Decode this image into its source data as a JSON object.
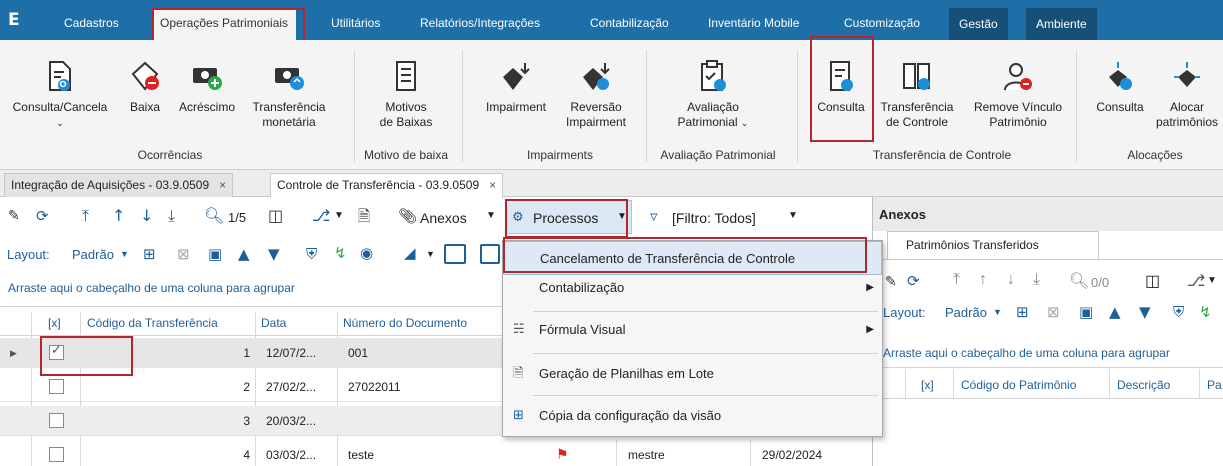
{
  "menubar": {
    "logo": "E",
    "tabs": [
      "Cadastros",
      "Operações Patrimoniais",
      "Utilitários",
      "Relatórios/Integrações",
      "Contabilização",
      "Inventário Mobile",
      "Customização",
      "Gestão",
      "Ambiente"
    ]
  },
  "ribbon": {
    "items": {
      "consulta_cancela": "Consulta/Cancela",
      "baixa": "Baixa",
      "acrescimo": "Acréscimo",
      "transf_monetaria_1": "Transferência",
      "transf_monetaria_2": "monetária",
      "motivos_1": "Motivos",
      "motivos_2": "de Baixas",
      "impairment": "Impairment",
      "reversao_1": "Reversão",
      "reversao_2": "Impairment",
      "avaliacao_1": "Avaliação",
      "avaliacao_2": "Patrimonial",
      "consulta": "Consulta",
      "transf_controle_1": "Transferência",
      "transf_controle_2": "de Controle",
      "remove_vinculo_1": "Remove Vínculo",
      "remove_vinculo_2": "Patrimônio",
      "alocacoes_consulta": "Consulta",
      "alocar_1": "Alocar",
      "alocar_2": "patrimônios"
    },
    "groups": {
      "ocorrencias": "Ocorrências",
      "motivo_baixa": "Motivo de baixa",
      "impairments": "Impairments",
      "avaliacao": "Avaliação Patrimonial",
      "transf_controle": "Transferência de Controle",
      "alocacoes": "Alocações"
    }
  },
  "doctabs": [
    {
      "label": "Integração de Aquisições - 03.9.0509"
    },
    {
      "label": "Controle de Transferência - 03.9.0509"
    }
  ],
  "toolbar": {
    "page": "1/5",
    "anexos": "Anexos",
    "processos": "Processos",
    "filtro": "[Filtro: Todos]",
    "layout_label": "Layout:",
    "layout_value": "Padrão"
  },
  "grid": {
    "group_hint": "Arraste aqui o cabeçalho de uma coluna para agrupar",
    "headers": {
      "check": "[x]",
      "codigo": "Código da Transferência",
      "data": "Data",
      "numero": "Número do Documento"
    },
    "rows": [
      {
        "codigo": "1",
        "data": "12/07/2...",
        "numero": "001",
        "checked": true
      },
      {
        "codigo": "2",
        "data": "27/02/2...",
        "numero": "27022011",
        "checked": false
      },
      {
        "codigo": "3",
        "data": "20/03/2...",
        "numero": "",
        "checked": false
      },
      {
        "codigo": "4",
        "data": "03/03/2...",
        "numero": "teste",
        "checked": false,
        "user": "mestre",
        "date2": "29/02/2024"
      }
    ]
  },
  "popup": {
    "items": [
      {
        "label": "Cancelamento de Transferência de Controle"
      },
      {
        "label": "Contabilização"
      },
      {
        "label": "Fórmula Visual"
      },
      {
        "label": "Geração de Planilhas em Lote"
      },
      {
        "label": "Cópia da configuração da visão"
      }
    ]
  },
  "rpane": {
    "title": "Anexos",
    "tab": "Patrimônios Transferidos",
    "page": "0/0",
    "layout_label": "Layout:",
    "layout_value": "Padrão",
    "group_hint": "Arraste aqui o cabeçalho de uma coluna para agrupar",
    "headers": {
      "check": "[x]",
      "codigo": "Código do Patrimônio",
      "descricao": "Descrição",
      "pa": "Pa"
    }
  },
  "colors": {
    "menubar": "#1e6fa8",
    "accent_blue": "#1f5f99",
    "highlight_red": "#b3262b",
    "menu_highlight": "#dde9f5"
  }
}
